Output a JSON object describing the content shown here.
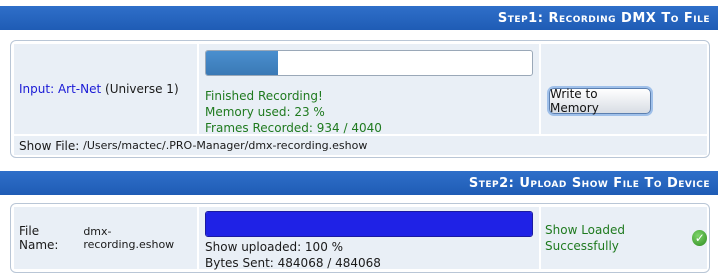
{
  "step1": {
    "header_prefix": "Step1:",
    "header_title": "Recording DMX To File",
    "input_label": "Input:",
    "input_link": "Art-Net",
    "input_universe": "(Universe 1)",
    "progress": 0.22,
    "status": "Finished Recording!",
    "memory_used": "Memory used: 23 %",
    "frames_recorded": "Frames Recorded: 934 / 4040",
    "write_button": "Write to Memory",
    "show_file_label": "Show File:",
    "show_file_path": "/Users/mactec/.PRO-Manager/dmx-recording.eshow"
  },
  "step2": {
    "header_prefix": "Step2:",
    "header_title": "Upload Show File To Device",
    "file_name_label": "File Name:",
    "file_name": "dmx-recording.eshow",
    "progress": 1.0,
    "show_uploaded": "Show uploaded: 100 %",
    "bytes_sent": "Bytes Sent: 484068 / 484068",
    "status": "Show Loaded Successfully"
  },
  "colors": {
    "header": "#2f6fc9",
    "progress1": "#4a8fcf",
    "progress2": "#1f22e6",
    "success": "#1f7a1f"
  }
}
